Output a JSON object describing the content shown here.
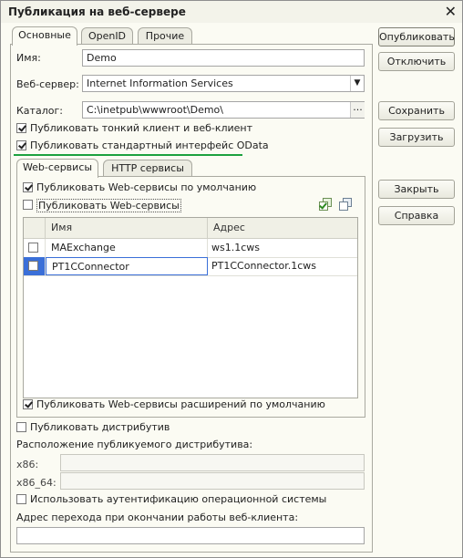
{
  "window": {
    "title": "Публикация на веб-сервере"
  },
  "tabs": [
    {
      "label": "Основные"
    },
    {
      "label": "OpenID"
    },
    {
      "label": "Прочие"
    }
  ],
  "fields": {
    "name_label": "Имя:",
    "name_value": "Demo",
    "webserver_label": "Веб-сервер:",
    "webserver_value": "Internet Information Services",
    "catalog_label": "Каталог:",
    "catalog_value": "C:\\inetpub\\wwwroot\\Demo\\"
  },
  "checks": {
    "thin_client": {
      "label": "Публиковать тонкий клиент и веб-клиент",
      "checked": true
    },
    "odata": {
      "label": "Публиковать стандартный интерфейс OData",
      "checked": true
    }
  },
  "subtabs": [
    {
      "label": "Web-сервисы"
    },
    {
      "label": "HTTP сервисы"
    }
  ],
  "webservices": {
    "default_check": {
      "label": "Публиковать Web-сервисы по умолчанию",
      "checked": true
    },
    "publish_check": {
      "label": "Публиковать Web-сервисы",
      "checked": false
    },
    "columns": {
      "name": "Имя",
      "address": "Адрес"
    },
    "rows": [
      {
        "checked": false,
        "name": "MAExchange",
        "address": "ws1.1cws"
      },
      {
        "checked": false,
        "name": "PT1CConnector",
        "address": "PT1CConnector.1cws"
      }
    ],
    "extensions_check": {
      "label": "Публиковать Web-сервисы расширений по умолчанию",
      "checked": true
    }
  },
  "distrib": {
    "publish_check": {
      "label": "Публиковать дистрибутив",
      "checked": false
    },
    "location_label": "Расположение публикуемого дистрибутива:",
    "x86_label": "x86:",
    "x86_64_label": "x86_64:"
  },
  "os_auth": {
    "label": "Использовать аутентификацию операционной системы",
    "checked": false
  },
  "exit_url_label": "Адрес перехода при окончании работы веб-клиента:",
  "buttons": {
    "publish": "Опубликовать",
    "unpublish": "Отключить",
    "save": "Сохранить",
    "load": "Загрузить",
    "close": "Закрыть",
    "help": "Справка"
  },
  "icons": {
    "close": "close-icon",
    "dropdown": "chevron-down-icon",
    "select": "ellipsis-icon",
    "check_all": "check-all-icon",
    "uncheck_all": "uncheck-all-icon"
  },
  "colors": {
    "accent_underline": "#1da13f",
    "selection": "#3a6fd8"
  }
}
